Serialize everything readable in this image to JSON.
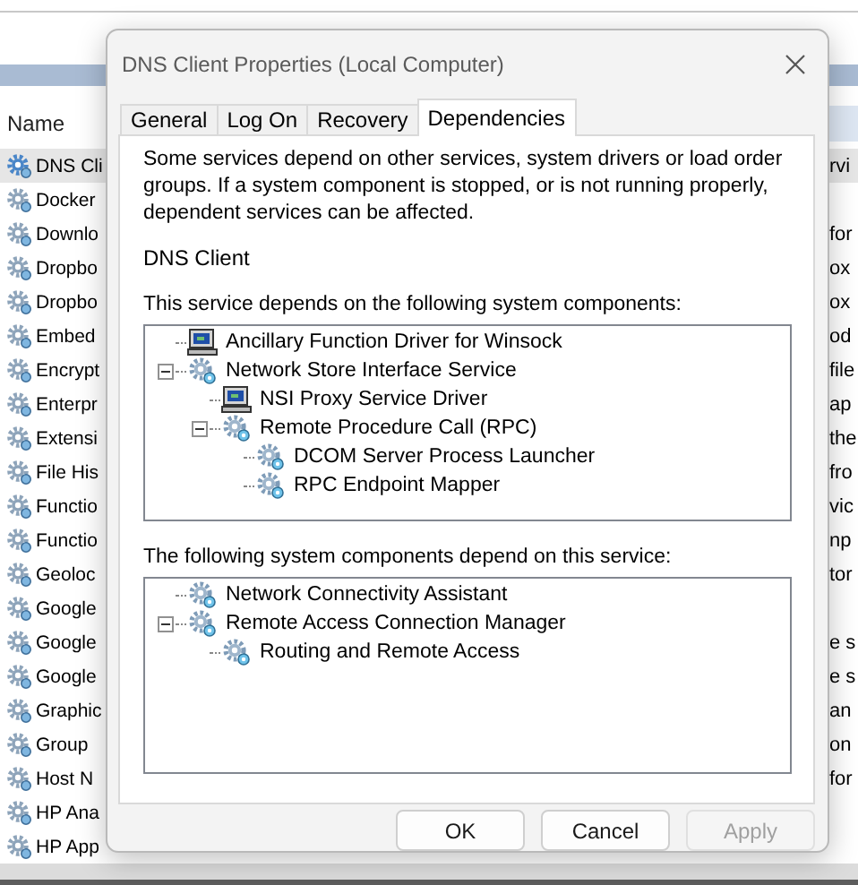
{
  "background_list": {
    "column_header": "Name",
    "rows": [
      {
        "name": "DNS Cli",
        "description": "rvi",
        "selected": true
      },
      {
        "name": "Docker",
        "selected": false
      },
      {
        "name": "Downlo",
        "description": "for",
        "selected": false
      },
      {
        "name": "Dropbo",
        "description": "ox",
        "selected": false
      },
      {
        "name": "Dropbo",
        "description": "ox",
        "selected": false
      },
      {
        "name": "Embed",
        "description": "od",
        "selected": false
      },
      {
        "name": "Encrypt",
        "description": "file",
        "selected": false
      },
      {
        "name": "Enterpr",
        "description": "ap",
        "selected": false
      },
      {
        "name": "Extensi",
        "description": "the",
        "selected": false
      },
      {
        "name": "File His",
        "description": "fro",
        "selected": false
      },
      {
        "name": "Functio",
        "description": "vic",
        "selected": false
      },
      {
        "name": "Functio",
        "description": "np",
        "selected": false
      },
      {
        "name": "Geoloc",
        "description": "tor",
        "selected": false
      },
      {
        "name": "Google",
        "selected": false
      },
      {
        "name": "Google",
        "description": "e s",
        "selected": false
      },
      {
        "name": "Google",
        "description": "e s",
        "selected": false
      },
      {
        "name": "Graphic",
        "description": "an",
        "selected": false
      },
      {
        "name": "Group",
        "description": "on",
        "selected": false
      },
      {
        "name": "Host N",
        "description": "for",
        "selected": false
      },
      {
        "name": "HP Ana",
        "selected": false
      },
      {
        "name": "HP App",
        "selected": false
      }
    ]
  },
  "dialog": {
    "title": "DNS Client Properties (Local Computer)",
    "tabs": [
      {
        "label": "General",
        "selected": false
      },
      {
        "label": "Log On",
        "selected": false
      },
      {
        "label": "Recovery",
        "selected": false
      },
      {
        "label": "Dependencies",
        "selected": true
      }
    ],
    "intro": "Some services depend on other services, system drivers or load order groups. If a system component is stopped, or is not running properly, dependent services can be affected.",
    "service_name": "DNS Client",
    "depends_on_label": "This service depends on the following system components:",
    "depends_on": [
      {
        "label": "Ancillary Function Driver for Winsock",
        "kind": "driver"
      },
      {
        "label": "Network Store Interface Service",
        "kind": "service",
        "expanded": true,
        "children": [
          {
            "label": "NSI Proxy Service Driver",
            "kind": "driver"
          },
          {
            "label": "Remote Procedure Call (RPC)",
            "kind": "service",
            "expanded": true,
            "children": [
              {
                "label": "DCOM Server Process Launcher",
                "kind": "service"
              },
              {
                "label": "RPC Endpoint Mapper",
                "kind": "service"
              }
            ]
          }
        ]
      }
    ],
    "dependents_label": "The following system components depend on this service:",
    "dependents": [
      {
        "label": "Network Connectivity Assistant",
        "kind": "service"
      },
      {
        "label": "Remote Access Connection Manager",
        "kind": "service",
        "expanded": true,
        "children": [
          {
            "label": "Routing and Remote Access",
            "kind": "service"
          }
        ]
      }
    ],
    "buttons": [
      {
        "label": "OK",
        "disabled": false
      },
      {
        "label": "Cancel",
        "disabled": false
      },
      {
        "label": "Apply",
        "disabled": true
      }
    ]
  }
}
